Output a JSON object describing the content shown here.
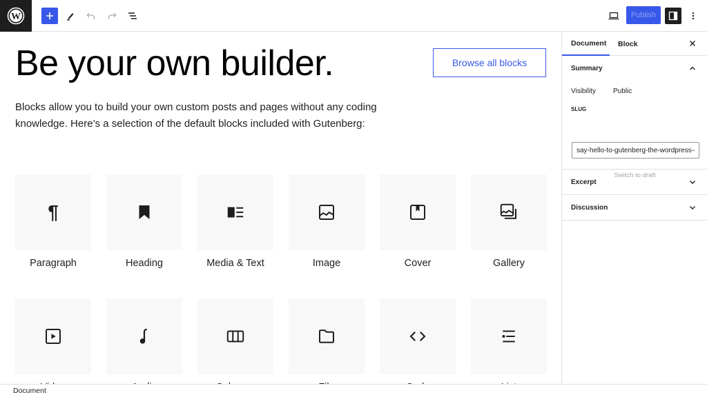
{
  "toolbar": {
    "logo": "wordpress-logo",
    "add_block": "Add block",
    "tools": "Edit tools",
    "undo": "Undo",
    "redo": "Redo",
    "outline": "Document overview",
    "preview": "Preview",
    "publish_label": "Publish",
    "settings": "Settings",
    "options": "Options"
  },
  "content": {
    "headline": "Be your own builder.",
    "browse_label": "Browse all blocks",
    "intro": "Blocks allow you to build your own custom posts and pages without any coding knowledge. Here’s a selection of the default blocks included with Gutenberg:",
    "blocks": [
      {
        "label": "Paragraph",
        "icon": "paragraph-icon"
      },
      {
        "label": "Heading",
        "icon": "heading-icon"
      },
      {
        "label": "Media & Text",
        "icon": "media-text-icon"
      },
      {
        "label": "Image",
        "icon": "image-icon"
      },
      {
        "label": "Cover",
        "icon": "cover-icon"
      },
      {
        "label": "Gallery",
        "icon": "gallery-icon"
      },
      {
        "label": "Video",
        "icon": "video-icon"
      },
      {
        "label": "Audio",
        "icon": "audio-icon"
      },
      {
        "label": "Columns",
        "icon": "columns-icon"
      },
      {
        "label": "File",
        "icon": "file-icon"
      },
      {
        "label": "Code",
        "icon": "code-icon"
      },
      {
        "label": "List",
        "icon": "list-icon"
      }
    ]
  },
  "footer": {
    "breadcrumb": "Document"
  },
  "sidebar": {
    "tabs": [
      "Document",
      "Block"
    ],
    "active_tab": "Document",
    "summary": {
      "title": "Summary",
      "visibility_label": "Visibility",
      "visibility_value": "Public",
      "slug_label": "SLUG",
      "slug_value": "say-hello-to-gutenberg-the-wordpress-ed",
      "switch_draft": "Switch to draft"
    },
    "panels": [
      "Excerpt",
      "Discussion"
    ]
  },
  "colors": {
    "accent": "#3858e9",
    "dark": "#1e1e1e",
    "tile_bg": "#f8f8f8"
  }
}
